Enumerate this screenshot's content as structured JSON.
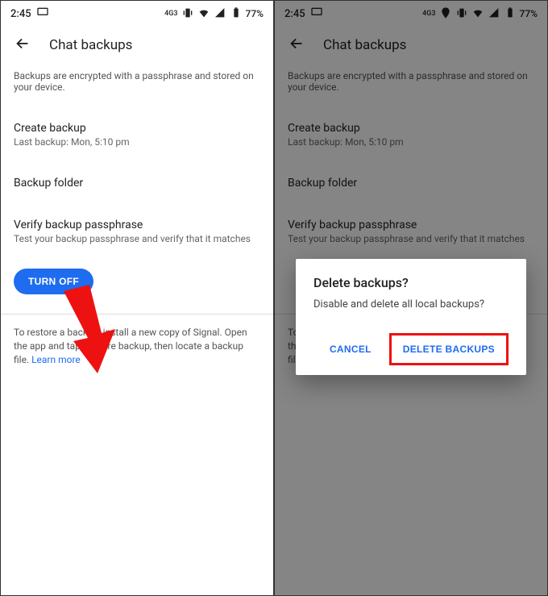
{
  "status": {
    "time": "2:45",
    "network_label": "4G3",
    "battery": "77%"
  },
  "header": {
    "title": "Chat backups"
  },
  "description": "Backups are encrypted with a passphrase and stored on your device.",
  "create": {
    "title": "Create backup",
    "subtitle": "Last backup: Mon, 5:10 pm"
  },
  "folder": {
    "title": "Backup folder"
  },
  "verify": {
    "title": "Verify backup passphrase",
    "subtitle": "Test your backup passphrase and verify that it matches"
  },
  "turnoff": {
    "label": "TURN OFF"
  },
  "restore": {
    "text_before": "To restore a backup, install a new copy of Signal. Open the app and tap Restore backup, then locate a backup file. ",
    "learn_more": "Learn more"
  },
  "dialog": {
    "title": "Delete backups?",
    "body": "Disable and delete all local backups?",
    "cancel": "CANCEL",
    "confirm": "DELETE BACKUPS"
  }
}
